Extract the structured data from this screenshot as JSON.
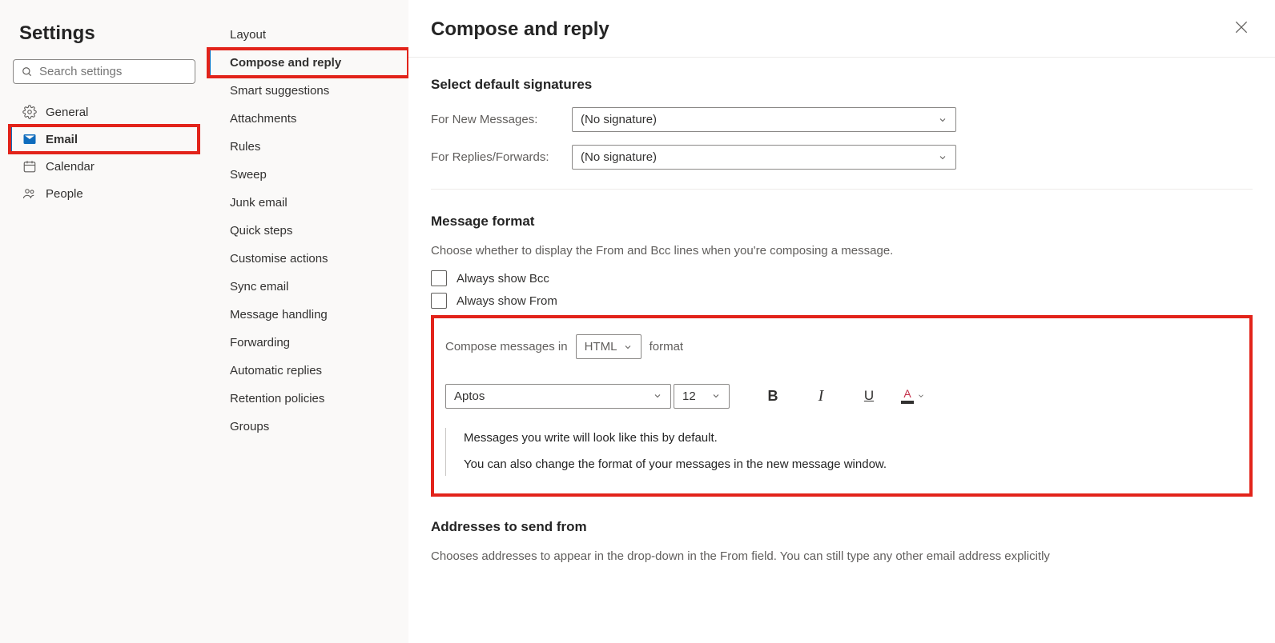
{
  "settings_title": "Settings",
  "search_placeholder": "Search settings",
  "nav": [
    {
      "label": "General"
    },
    {
      "label": "Email"
    },
    {
      "label": "Calendar"
    },
    {
      "label": "People"
    }
  ],
  "sub_nav": [
    {
      "label": "Layout"
    },
    {
      "label": "Compose and reply"
    },
    {
      "label": "Smart suggestions"
    },
    {
      "label": "Attachments"
    },
    {
      "label": "Rules"
    },
    {
      "label": "Sweep"
    },
    {
      "label": "Junk email"
    },
    {
      "label": "Quick steps"
    },
    {
      "label": "Customise actions"
    },
    {
      "label": "Sync email"
    },
    {
      "label": "Message handling"
    },
    {
      "label": "Forwarding"
    },
    {
      "label": "Automatic replies"
    },
    {
      "label": "Retention policies"
    },
    {
      "label": "Groups"
    }
  ],
  "panel_title": "Compose and reply",
  "signatures": {
    "heading": "Select default signatures",
    "new_label": "For New Messages:",
    "new_value": "(No signature)",
    "reply_label": "For Replies/Forwards:",
    "reply_value": "(No signature)"
  },
  "format": {
    "heading": "Message format",
    "desc": "Choose whether to display the From and Bcc lines when you're composing a message.",
    "bcc_label": "Always show Bcc",
    "from_label": "Always show From",
    "compose_prefix": "Compose messages in",
    "compose_value": "HTML",
    "compose_suffix": "format",
    "font_name": "Aptos",
    "font_size": "12",
    "preview1": "Messages you write will look like this by default.",
    "preview2": "You can also change the format of your messages in the new message window."
  },
  "addresses": {
    "heading": "Addresses to send from",
    "desc": "Chooses addresses to appear in the drop-down in the From field. You can still type any other email address explicitly"
  }
}
